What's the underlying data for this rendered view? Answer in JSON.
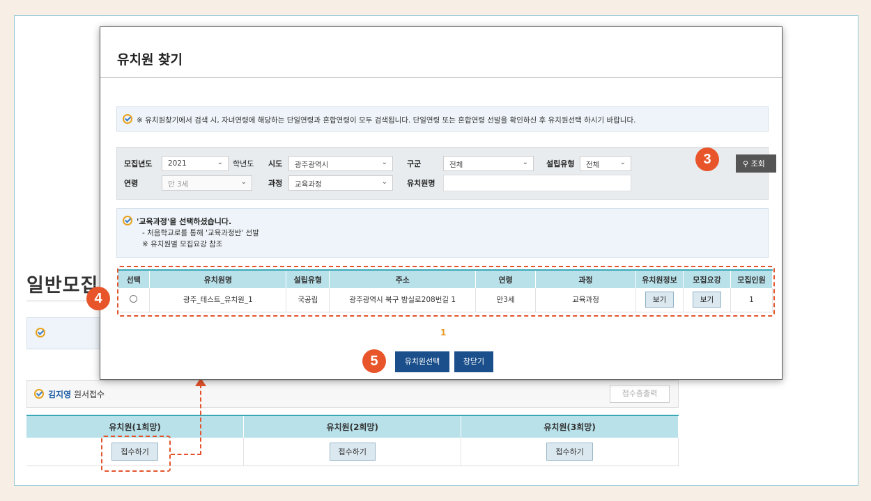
{
  "background": {
    "page_title": "일반모집",
    "applicant_name": "김지영",
    "applicant_suffix": " 원서접수",
    "receipt_print_label": "접수증출력",
    "choices": [
      {
        "header": "유치원(1희망)",
        "button": "접수하기"
      },
      {
        "header": "유치원(2희망)",
        "button": "접수하기"
      },
      {
        "header": "유치원(3희망)",
        "button": "접수하기"
      }
    ]
  },
  "modal": {
    "title": "유치원 찾기",
    "notice": "※ 유치원찾기에서 검색 시, 자녀연령에 해당하는 단일연령과 혼합연령이 모두 검색됩니다. 단일연령 또는 혼합연령 선발을 확인하신 후 유치원선택 하시기 바랍니다.",
    "filters": {
      "year_label": "모집년도",
      "year_value": "2021",
      "year_suffix": "학년도",
      "city_label": "시도",
      "city_value": "광주광역시",
      "district_label": "구군",
      "district_value": "전체",
      "type_label": "설립유형",
      "type_value": "전체",
      "age_label": "연령",
      "age_value": "만 3세",
      "course_label": "과정",
      "course_value": "교육과정",
      "name_label": "유치원명",
      "name_value": "",
      "search_label": "조회"
    },
    "course_notice": {
      "line1": "'교육과정'을 선택하셨습니다.",
      "line2": "- 처음학교로를 통해 '교육과정반' 선발",
      "line3": "※ 유치원별 모집요강 참조"
    },
    "table": {
      "headers": [
        "선택",
        "유치원명",
        "설립유형",
        "주소",
        "연령",
        "과정",
        "유치원정보",
        "모집요강",
        "모집인원"
      ],
      "row": {
        "name": "광주_테스트_유치원_1",
        "type": "국공립",
        "address": "광주광역시 북구 밤실로208번길 1",
        "age": "만3세",
        "course": "교육과정",
        "info_btn": "보기",
        "guide_btn": "보기",
        "count": "1"
      }
    },
    "page": "1",
    "select_btn": "유치원선택",
    "close_btn": "창닫기"
  },
  "badges": {
    "b3": "3",
    "b4": "4",
    "b5": "5"
  },
  "colors": {
    "accent": "#e8552a",
    "primary_button": "#1a4f8b",
    "table_header": "#b9e1ea"
  }
}
